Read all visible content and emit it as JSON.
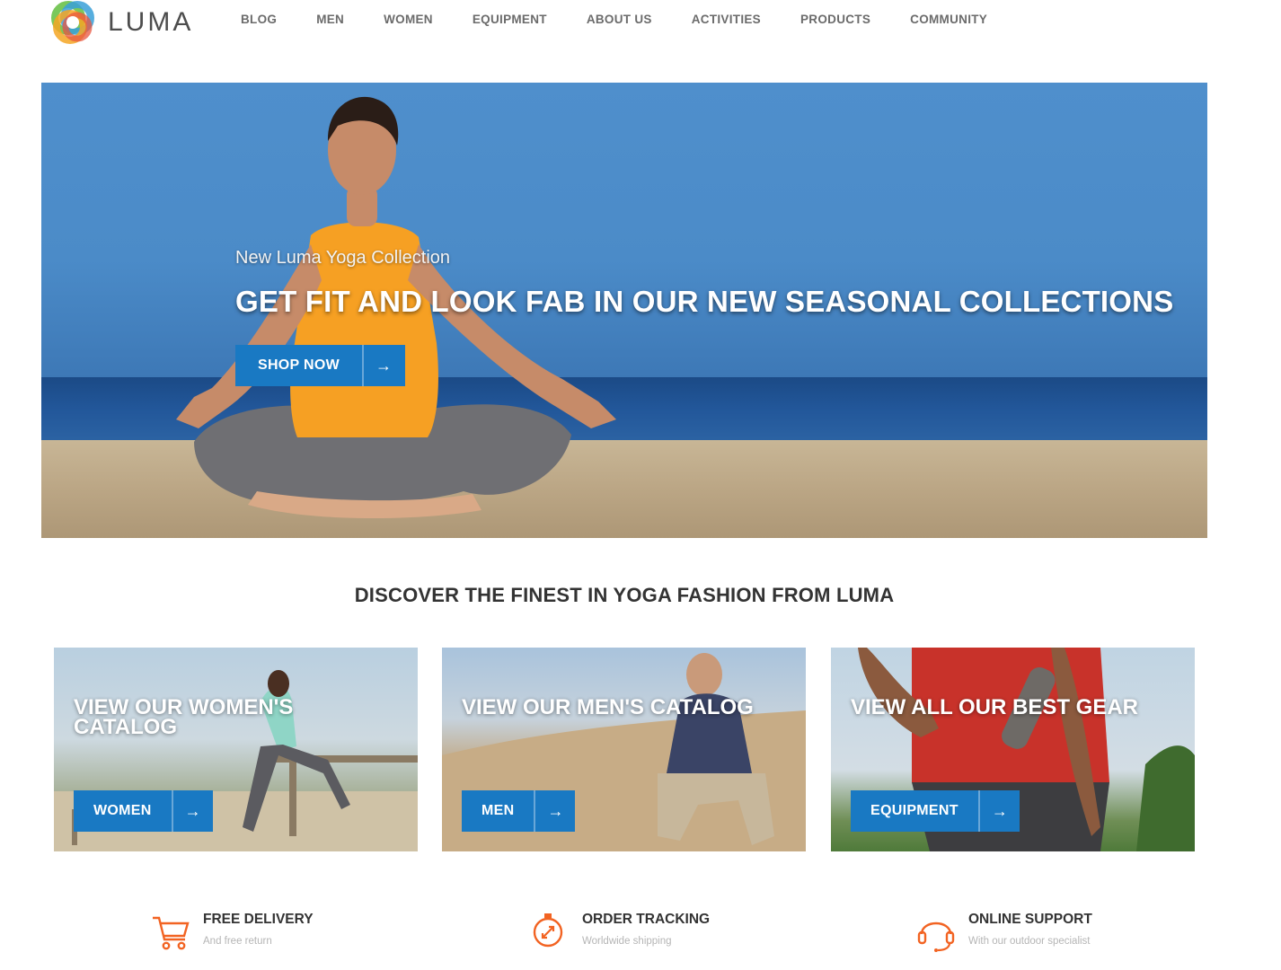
{
  "header": {
    "logo_text": "LUMA",
    "nav": [
      "BLOG",
      "MEN",
      "WOMEN",
      "EQUIPMENT",
      "ABOUT US",
      "ACTIVITIES",
      "PRODUCTS",
      "COMMUNITY"
    ]
  },
  "hero": {
    "subtitle": "New Luma Yoga Collection",
    "title": "GET FIT AND LOOK FAB IN OUR NEW SEASONAL COLLECTIONS",
    "button_label": "SHOP NOW",
    "button_icon": "arrow-right-icon"
  },
  "discover": {
    "heading": "DISCOVER THE FINEST IN YOGA FASHION FROM LUMA"
  },
  "tiles": [
    {
      "title": "VIEW OUR WOMEN'S CATALOG",
      "button_label": "WOMEN"
    },
    {
      "title": "VIEW OUR MEN'S CATALOG",
      "button_label": "MEN"
    },
    {
      "title": "VIEW ALL OUR BEST GEAR",
      "button_label": "EQUIPMENT"
    }
  ],
  "features": [
    {
      "title": "FREE DELIVERY",
      "subtitle": "And free return",
      "icon": "cart-icon"
    },
    {
      "title": "ORDER TRACKING",
      "subtitle": "Worldwide shipping",
      "icon": "tracking-icon"
    },
    {
      "title": "ONLINE SUPPORT",
      "subtitle": "With our outdoor specialist",
      "icon": "headset-icon"
    }
  ],
  "colors": {
    "accent": "#1979c3",
    "feature_icon": "#f26322",
    "heading_text": "#333333",
    "nav_text": "#6b6b6b"
  }
}
